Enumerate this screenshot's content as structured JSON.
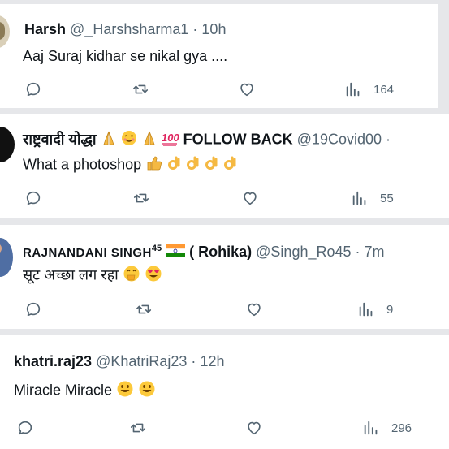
{
  "tweets": [
    {
      "name": "Harsh",
      "handle": "@_Harshsharma1",
      "sep": "·",
      "time": "10h",
      "text": "Aaj Suraj kidhar se nikal gya ....",
      "views": "164"
    },
    {
      "name": "राष्ट्रवादी योद्धा",
      "name_suffix": "FOLLOW BACK",
      "handle": "@19Covid00",
      "sep": "·",
      "text": "What a photoshop",
      "views": "55"
    },
    {
      "name": "RAJNANDANI SINGH",
      "name_sup": "45",
      "name_suffix": "( Rohika)",
      "handle": "@Singh_Ro45",
      "sep": "·",
      "time": "7m",
      "text": "सूट अच्छा लग रहा",
      "views": "9"
    },
    {
      "name": "khatri.raj23",
      "handle": "@KhatriRaj23",
      "sep": "·",
      "time": "12h",
      "text": "Miracle Miracle",
      "views": "296"
    }
  ],
  "icons": {
    "reply": "speech-bubble-icon",
    "retweet": "retweet-icon",
    "like": "heart-icon",
    "views": "bar-chart-icon"
  },
  "colors": {
    "background": "#e6e7ea",
    "card": "#ffffff",
    "secondary_text": "#536471",
    "primary_text": "#0f1419"
  }
}
